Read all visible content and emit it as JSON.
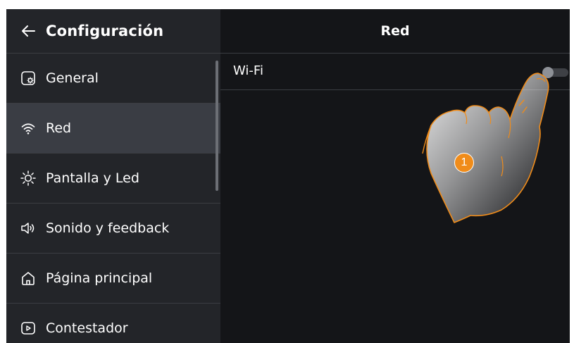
{
  "sidebar": {
    "title": "Configuración",
    "items": [
      {
        "label": "General",
        "icon": "settings-icon"
      },
      {
        "label": "Red",
        "icon": "wifi-icon",
        "active": true
      },
      {
        "label": "Pantalla y Led",
        "icon": "brightness-icon"
      },
      {
        "label": "Sonido y feedback",
        "icon": "speaker-icon"
      },
      {
        "label": "Página principal",
        "icon": "home-icon"
      },
      {
        "label": "Contestador",
        "icon": "answering-machine-icon"
      }
    ]
  },
  "main": {
    "title": "Red",
    "wifi": {
      "label": "Wi-Fi",
      "enabled": false
    }
  },
  "annotation": {
    "step": "1"
  },
  "colors": {
    "accent": "#f08c1a",
    "background": "#141518",
    "sidebar": "#232529",
    "active_item": "#3a3d44"
  }
}
